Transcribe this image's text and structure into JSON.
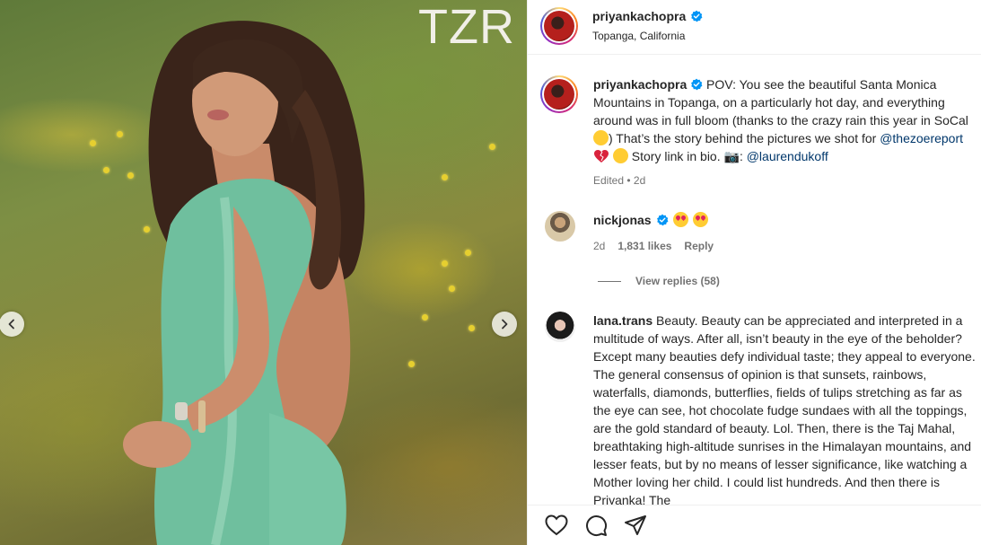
{
  "media": {
    "brand_logo": "TZR",
    "prev_icon": "chevron-left-icon",
    "next_icon": "chevron-right-icon"
  },
  "header": {
    "username": "priyankachopra",
    "verified": true,
    "location": "Topanga, California"
  },
  "caption": {
    "username": "priyankachopra",
    "text_1": "POV: You see the beautiful Santa Monica Mountains in Topanga, on a particularly hot day, and everything around was in full bloom (thanks to the crazy rain this year in SoCal ",
    "text_2": ") That’s the story behind the pictures we shot for ",
    "mention_1": "@thezoereport",
    "text_3": " Story link in bio. ",
    "camera_emoji": "📷",
    "text_4": ": ",
    "mention_2": "@laurendukoff",
    "meta": "Edited • 2d"
  },
  "comments": [
    {
      "username": "nickjonas",
      "verified": true,
      "text": "",
      "emojis": [
        "heart-eyes",
        "heart-eyes"
      ],
      "age": "2d",
      "likes": "1,831 likes",
      "reply_label": "Reply",
      "view_replies": "View replies (58)"
    },
    {
      "username": "lana.trans",
      "text": "Beauty. Beauty can be appreciated and interpreted in a multitude of ways. After all, isn’t beauty in the eye of the beholder? Except many beauties defy individual taste; they appeal to everyone. The general consensus of opinion is that sunsets, rainbows, waterfalls, diamonds, butterflies, fields of tulips stretching as far as the eye can see, hot chocolate fudge sundaes with all the toppings, are the gold standard of beauty. Lol. Then, there is the Taj Mahal, breathtaking high-altitude sunrises in the Himalayan mountains, and lesser feats, but by no means of lesser significance, like watching a Mother loving her child. I could list hundreds. And then there is Priyanka! The"
    }
  ],
  "actions": {
    "like_icon": "heart-icon",
    "comment_icon": "comment-icon",
    "share_icon": "share-icon"
  },
  "colors": {
    "verified": "#0095f6",
    "link": "#00376b",
    "muted": "#737373",
    "text": "#262626"
  }
}
